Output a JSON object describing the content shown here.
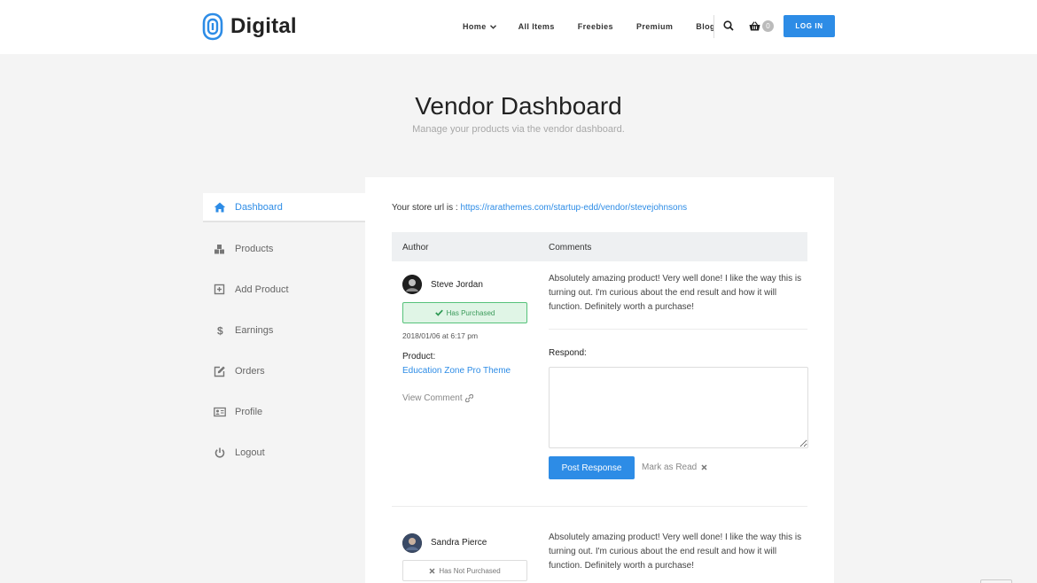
{
  "brand": {
    "name": "Digital",
    "accent": "#2d8ce6"
  },
  "nav": {
    "home": "Home",
    "all_items": "All Items",
    "freebies": "Freebies",
    "premium": "Premium",
    "blog": "Blog",
    "cart_count": "0",
    "login": "LOG IN"
  },
  "page": {
    "title": "Vendor Dashboard",
    "subtitle": "Manage your products via the vendor dashboard."
  },
  "sidebar": {
    "items": [
      {
        "label": "Dashboard",
        "icon": "home-icon",
        "active": true
      },
      {
        "label": "Products",
        "icon": "cubes-icon"
      },
      {
        "label": "Add Product",
        "icon": "plus-square-icon"
      },
      {
        "label": "Earnings",
        "icon": "dollar-icon"
      },
      {
        "label": "Orders",
        "icon": "edit-icon"
      },
      {
        "label": "Profile",
        "icon": "id-card-icon"
      },
      {
        "label": "Logout",
        "icon": "power-icon"
      }
    ]
  },
  "store": {
    "label": "Your store url is : ",
    "url": "https://rarathemes.com/startup-edd/vendor/stevejohnsons"
  },
  "table": {
    "col_author": "Author",
    "col_comments": "Comments"
  },
  "comments": [
    {
      "author": "Steve Jordan",
      "badge": "Has Purchased",
      "date": "2018/01/06 at 6:17 pm",
      "product_label": "Product:",
      "product": "Education Zone Pro Theme",
      "view": "View Comment",
      "text": "Absolutely amazing product! Very well done! I like the way this is turning out. I'm curious about the end result and how it will function. Definitely worth a purchase!",
      "respond_label": "Respond:",
      "post_button": "Post Response",
      "mark_read": "Mark as Read"
    },
    {
      "author": "Sandra Pierce",
      "badge": "Has Not Purchased",
      "text": "Absolutely amazing product! Very well done! I like the way this is turning out. I'm curious about the end result and how it will function. Definitely worth a purchase!"
    }
  ]
}
